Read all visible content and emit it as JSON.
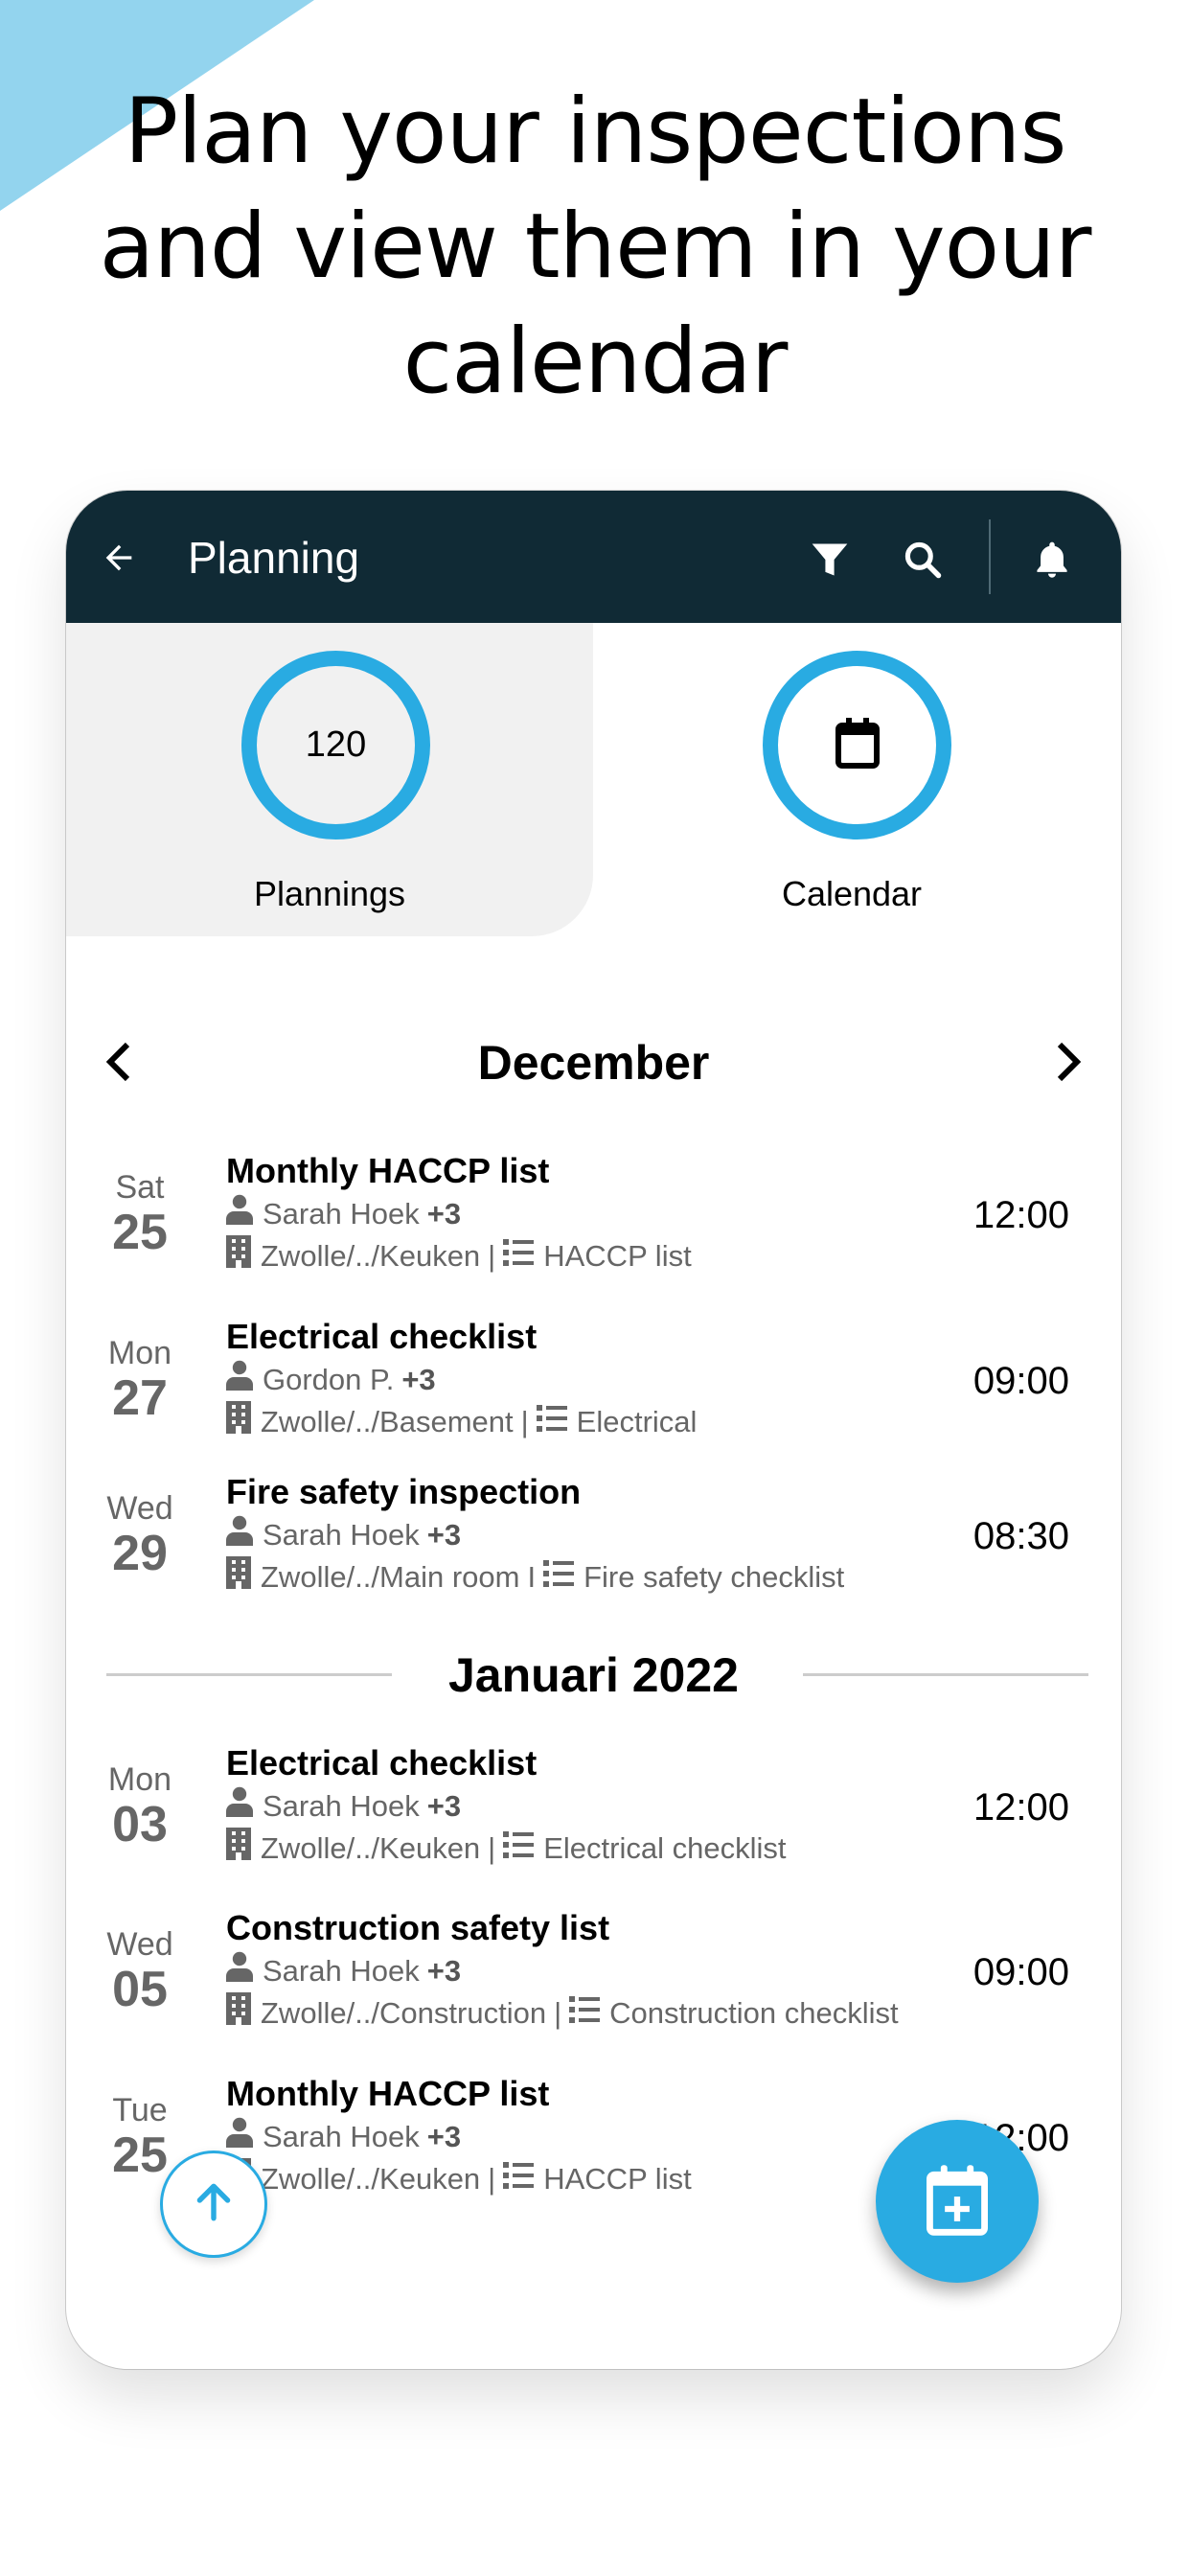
{
  "headline": {
    "lines": [
      "Plan your inspections",
      "and view them in your",
      "calendar"
    ]
  },
  "colors": {
    "header_bg": "#102a35",
    "accent": "#29abe2",
    "corner_triangle": "#93d4ee",
    "secondary_text": "#666666"
  },
  "app_header": {
    "title": "Planning",
    "icons": [
      "back-arrow-icon",
      "filter-icon",
      "search-icon",
      "bell-icon"
    ]
  },
  "tabs": [
    {
      "label": "Plannings",
      "count": "120",
      "active": true
    },
    {
      "label": "Calendar",
      "icon": "calendar-icon",
      "active": false
    }
  ],
  "month_nav": {
    "title": "December",
    "prev_icon": "chevron-left-icon",
    "next_icon": "chevron-right-icon"
  },
  "sections": [
    {
      "label": "December",
      "items": [
        {
          "day": "Sat",
          "date": "25",
          "title": "Monthly HACCP list",
          "person": "Sarah Hoek",
          "extra": "+3",
          "location": "Zwolle/../Keuken",
          "separator": "|",
          "checklist": "HACCP list",
          "time": "12:00"
        },
        {
          "day": "Mon",
          "date": "27",
          "title": "Electrical checklist",
          "person": "Gordon P.",
          "extra": "+3",
          "location": "Zwolle/../Basement",
          "separator": "|",
          "checklist": "Electrical",
          "time": "09:00"
        },
        {
          "day": "Wed",
          "date": "29",
          "title": "Fire safety inspection",
          "person": "Sarah Hoek",
          "extra": "+3",
          "location": "Zwolle/../Main room",
          "separator": "I",
          "checklist": "Fire safety checklist",
          "time": "08:30"
        }
      ]
    },
    {
      "label": "Januari 2022",
      "items": [
        {
          "day": "Mon",
          "date": "03",
          "title": "Electrical checklist",
          "person": "Sarah Hoek",
          "extra": "+3",
          "location": "Zwolle/../Keuken",
          "separator": "|",
          "checklist": "Electrical checklist",
          "time": "12:00"
        },
        {
          "day": "Wed",
          "date": "05",
          "title": "Construction safety list",
          "person": "Sarah Hoek",
          "extra": "+3",
          "location": "Zwolle/../Construction",
          "separator": "|",
          "checklist": "Construction checklist",
          "time": "09:00"
        },
        {
          "day": "Tue",
          "date": "25",
          "title": "Monthly HACCP list",
          "person": "Sarah Hoek",
          "extra": "+3",
          "location": "Zwolle/../Keuken",
          "separator": "|",
          "checklist": "HACCP list",
          "time": "12:00"
        }
      ]
    }
  ],
  "floating_buttons": {
    "scroll_top_icon": "arrow-up-icon",
    "add_planning_icon": "calendar-plus-icon"
  }
}
